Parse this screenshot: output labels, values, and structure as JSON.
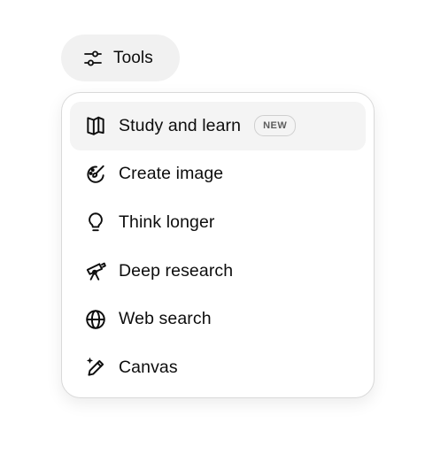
{
  "tools_button": {
    "label": "Tools",
    "icon": "sliders-icon"
  },
  "menu": {
    "items": [
      {
        "label": "Study and learn",
        "icon": "open-book-icon",
        "badge": "NEW",
        "active": true
      },
      {
        "label": "Create image",
        "icon": "palette-brush-icon"
      },
      {
        "label": "Think longer",
        "icon": "lightbulb-icon"
      },
      {
        "label": "Deep research",
        "icon": "telescope-icon"
      },
      {
        "label": "Web search",
        "icon": "globe-icon"
      },
      {
        "label": "Canvas",
        "icon": "pencil-sparkle-icon"
      }
    ]
  }
}
